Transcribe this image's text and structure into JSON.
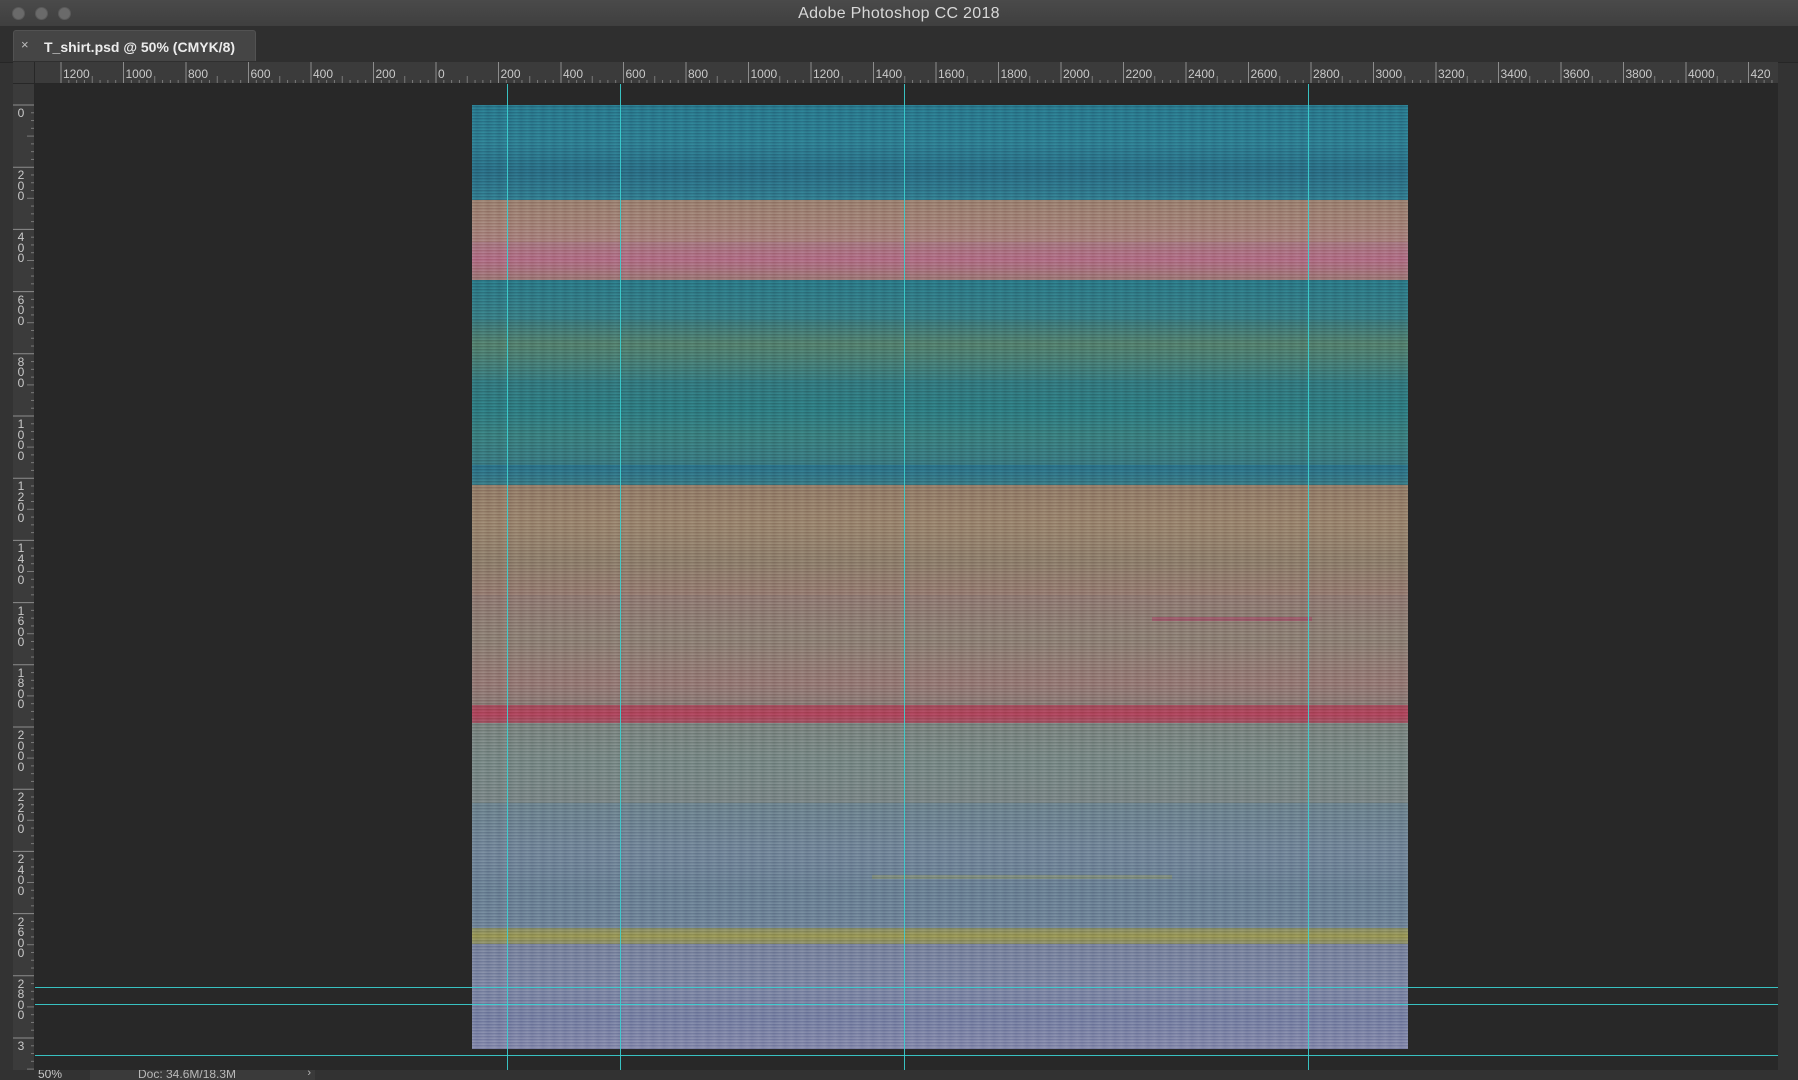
{
  "window": {
    "title": "Adobe Photoshop CC 2018"
  },
  "tabs": [
    {
      "close_glyph": "×",
      "label": "T_shirt.psd @ 50% (CMYK/8)"
    }
  ],
  "rulers": {
    "horizontal_labels": [
      "1200",
      "1000",
      "800",
      "600",
      "400",
      "200",
      "0",
      "200",
      "400",
      "600",
      "800",
      "1000",
      "1200",
      "1400",
      "1600",
      "1800",
      "2000",
      "2200",
      "2400",
      "2600",
      "2800",
      "3000",
      "3200",
      "3400",
      "3600",
      "3800",
      "4000",
      "420"
    ],
    "vertical_labels": [
      "0",
      "200",
      "400",
      "600",
      "800",
      "1000",
      "1200",
      "1400",
      "1600",
      "1800",
      "2000",
      "2200",
      "2400",
      "2600",
      "2800",
      "3"
    ]
  },
  "status": {
    "zoom": "50%",
    "doc_info": "Doc: 34.6M/18.3M",
    "arrow_glyph": "›"
  },
  "colors": {
    "guide": "#3ad2d2",
    "canvas_bg": "#282828"
  }
}
